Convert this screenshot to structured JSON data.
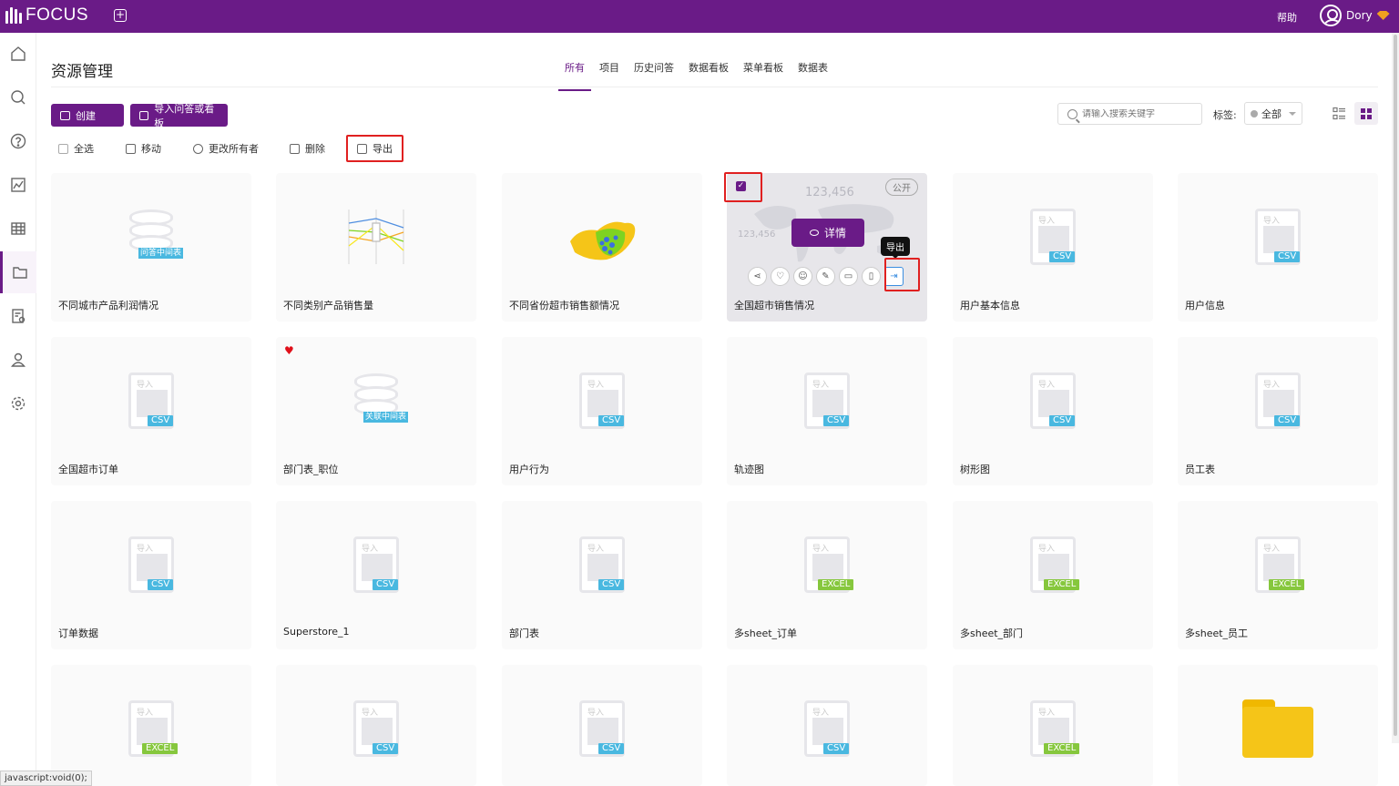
{
  "app": {
    "name": "FOCUS",
    "help": "帮助",
    "user": "Dory"
  },
  "page": {
    "title": "资源管理"
  },
  "tabs": [
    "所有",
    "项目",
    "历史问答",
    "数据看板",
    "菜单看板",
    "数据表"
  ],
  "actions": {
    "create": "创建",
    "import": "导入问答或看板"
  },
  "search": {
    "placeholder": "请输入搜索关键字"
  },
  "tag": {
    "label": "标签:",
    "value": "全部"
  },
  "toolbar": {
    "select_all": "全选",
    "move": "移动",
    "change_owner": "更改所有者",
    "delete": "删除",
    "export": "导出"
  },
  "selected_card": {
    "public": "公开",
    "detail": "详情",
    "tooltip": "导出",
    "kpi": "123,456"
  },
  "cards": [
    {
      "name": "不同城市产品利润情况",
      "badge": "问答中间表"
    },
    {
      "name": "不同类别产品销售量"
    },
    {
      "name": "不同省份超市销售额情况"
    },
    {
      "name": "全国超市销售情况"
    },
    {
      "name": "用户基本信息",
      "badge": "CSV",
      "imp": "导入"
    },
    {
      "name": "用户信息",
      "badge": "CSV",
      "imp": "导入"
    },
    {
      "name": "全国超市订单",
      "badge": "CSV",
      "imp": "导入"
    },
    {
      "name": "部门表_职位",
      "badge": "关联中间表"
    },
    {
      "name": "用户行为",
      "badge": "CSV",
      "imp": "导入"
    },
    {
      "name": "轨迹图",
      "badge": "CSV",
      "imp": "导入"
    },
    {
      "name": "树形图",
      "badge": "CSV",
      "imp": "导入"
    },
    {
      "name": "员工表",
      "badge": "CSV",
      "imp": "导入"
    },
    {
      "name": "订单数据",
      "badge": "CSV",
      "imp": "导入"
    },
    {
      "name": "Superstore_1",
      "badge": "CSV",
      "imp": "导入"
    },
    {
      "name": "部门表",
      "badge": "CSV",
      "imp": "导入"
    },
    {
      "name": "多sheet_订单",
      "badge": "EXCEL",
      "imp": "导入"
    },
    {
      "name": "多sheet_部门",
      "badge": "EXCEL",
      "imp": "导入"
    },
    {
      "name": "多sheet_员工",
      "badge": "EXCEL",
      "imp": "导入"
    },
    {
      "badge": "EXCEL",
      "imp": "导入"
    },
    {
      "badge": "CSV",
      "imp": "导入"
    },
    {
      "badge": "CSV",
      "imp": "导入"
    },
    {
      "badge": "CSV",
      "imp": "导入"
    },
    {
      "badge": "EXCEL",
      "imp": "导入"
    },
    {}
  ],
  "status_bar": "javascript:void(0);",
  "colors": {
    "brand": "#6a1b87",
    "csv": "#49b8e0",
    "excel": "#86c73d",
    "highlight": "#e02020"
  }
}
